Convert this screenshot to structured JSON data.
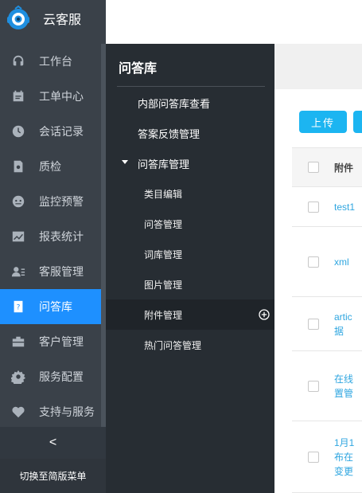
{
  "app": {
    "title": "云客服"
  },
  "sidebar": {
    "items": [
      {
        "label": "工作台",
        "icon": "headset-icon"
      },
      {
        "label": "工单中心",
        "icon": "ticket-icon"
      },
      {
        "label": "会话记录",
        "icon": "clock-icon"
      },
      {
        "label": "质检",
        "icon": "document-icon"
      },
      {
        "label": "监控预警",
        "icon": "monitor-icon"
      },
      {
        "label": "报表统计",
        "icon": "chart-icon"
      },
      {
        "label": "客服管理",
        "icon": "agent-icon"
      },
      {
        "label": "问答库",
        "icon": "qa-icon",
        "active": true
      },
      {
        "label": "客户管理",
        "icon": "briefcase-icon"
      },
      {
        "label": "服务配置",
        "icon": "gear-icon"
      },
      {
        "label": "支持与服务",
        "icon": "heart-icon"
      }
    ],
    "collapse_glyph": "<",
    "switch_label": "切换至简版菜单"
  },
  "flyout": {
    "title": "问答库",
    "items": [
      {
        "label": "内部问答库查看",
        "level": 1
      },
      {
        "label": "答案反馈管理",
        "level": 1
      },
      {
        "label": "问答库管理",
        "level": 1,
        "expanded": true
      },
      {
        "label": "类目编辑",
        "level": 2
      },
      {
        "label": "问答管理",
        "level": 2
      },
      {
        "label": "词库管理",
        "level": 2
      },
      {
        "label": "图片管理",
        "level": 2
      },
      {
        "label": "附件管理",
        "level": 2,
        "hovered": true
      },
      {
        "label": "热门问答管理",
        "level": 2
      }
    ]
  },
  "content": {
    "upload_label": "上传",
    "table": {
      "header": "附件",
      "rows": [
        {
          "lines": [
            "test1"
          ]
        },
        {
          "lines": [
            "xml"
          ]
        },
        {
          "lines": [
            "artic",
            "据"
          ]
        },
        {
          "lines": [
            "在线",
            "置管"
          ]
        },
        {
          "lines": [
            "1月1",
            "布在",
            "变更"
          ]
        }
      ]
    }
  },
  "colors": {
    "sidebar_bg": "#3a4149",
    "flyout_bg": "#272d33",
    "active_blue": "#1e90ff",
    "upload_button": "#1cb5f1",
    "link_blue": "#2fa6e0"
  }
}
